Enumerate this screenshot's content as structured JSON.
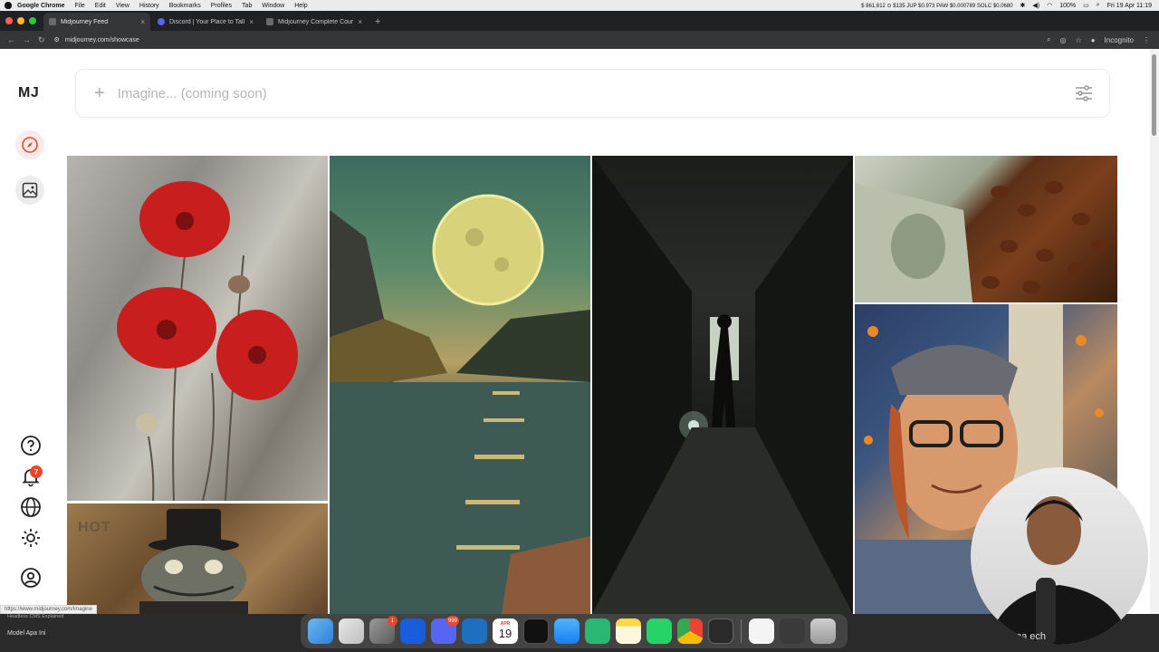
{
  "menubar": {
    "app_name": "Google Chrome",
    "items": [
      "File",
      "Edit",
      "View",
      "History",
      "Bookmarks",
      "Profiles",
      "Tab",
      "Window",
      "Help"
    ],
    "ticker": "$ 861,812 ⊙ $135 JUP $0.973 PAW $0.000789 SOLC $0.0680",
    "battery": "100%",
    "datetime": "Fri 19 Apr 11:19"
  },
  "tabs": [
    {
      "title": "Midjourney Feed",
      "active": true
    },
    {
      "title": "Discord | Your Place to Talk a",
      "active": false
    },
    {
      "title": "Midjourney Complete Course",
      "active": false
    }
  ],
  "toolbar": {
    "url": "midjourney.com/showcase",
    "incognito_label": "Incognito"
  },
  "sidebar": {
    "logo": "MJ",
    "notification_count": "7"
  },
  "search": {
    "placeholder": "Imagine... (coming soon)"
  },
  "feed": {
    "images": [
      {
        "subject": "red poppies textured painting"
      },
      {
        "subject": "toad in top hat"
      },
      {
        "subject": "full moon over lake at sunset"
      },
      {
        "subject": "figure in dark corridor with lantern"
      },
      {
        "subject": "coffee beans and dollar bill"
      },
      {
        "subject": "illustrated portrait man with glasses and butterflies"
      }
    ],
    "visible_text": "HOT"
  },
  "status_url": "https://www.midjourney.com/imagine",
  "dock": {
    "left_label": "Model Apa Ini",
    "left_sublabel": "Headless CMS Explained",
    "calendar_month": "APR",
    "calendar_day": "19",
    "settings_badge": "1",
    "discord_badge": "999",
    "apps": [
      "finder",
      "launchpad",
      "system-settings",
      "bitwarden",
      "discord",
      "vscode",
      "calendar",
      "terminal",
      "mail",
      "gitmind",
      "notes",
      "whatsapp",
      "chrome",
      "activity-monitor",
      "preview",
      "screenshot",
      "trash"
    ]
  },
  "webcam": {
    "shirt_text": "oa  ech"
  },
  "colors": {
    "accent": "#e8472c",
    "explore_bg": "#fdeaea"
  }
}
